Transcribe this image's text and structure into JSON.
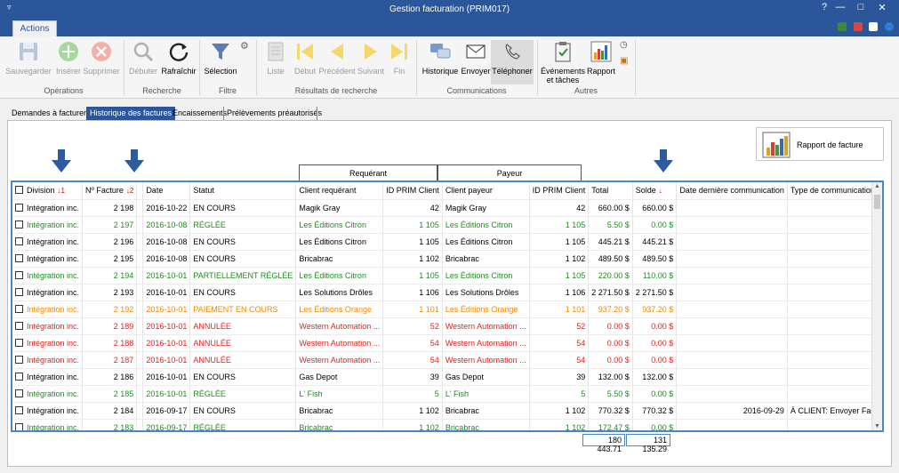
{
  "window": {
    "title": "Gestion facturation (PRIM017)"
  },
  "ribbon_tab": "Actions",
  "ribbon": {
    "buttons": [
      {
        "label": "Sauvegarder",
        "icon": "save-icon",
        "enabled": false
      },
      {
        "label": "Insérer",
        "icon": "plus-icon",
        "enabled": false
      },
      {
        "label": "Supprimer",
        "icon": "delete-icon",
        "enabled": false
      },
      {
        "label": "Débuter",
        "icon": "search-icon",
        "enabled": false
      },
      {
        "label": "Rafraîchir",
        "icon": "refresh-icon",
        "enabled": true
      },
      {
        "label": "Sélection",
        "icon": "filter-icon",
        "enabled": true
      },
      {
        "label": "Liste",
        "icon": "list-icon",
        "enabled": false
      },
      {
        "label": "Début",
        "icon": "first-icon",
        "enabled": false
      },
      {
        "label": "Précédent",
        "icon": "previous-icon",
        "enabled": false
      },
      {
        "label": "Suivant",
        "icon": "next-icon",
        "enabled": false
      },
      {
        "label": "Fin",
        "icon": "last-icon",
        "enabled": false
      },
      {
        "label": "Historique",
        "icon": "chat-history-icon",
        "enabled": true
      },
      {
        "label": "Envoyer",
        "icon": "email-icon",
        "enabled": true
      },
      {
        "label": "Téléphoner",
        "icon": "phone-icon",
        "enabled": true
      },
      {
        "label": "Événements\net tâches",
        "icon": "clipboard-check-icon",
        "enabled": true
      },
      {
        "label": "Rapport",
        "icon": "bar-chart-icon",
        "enabled": true
      }
    ],
    "groups": [
      "Opérations",
      "Recherche",
      "Filtre",
      "Résultats de recherche",
      "Communications",
      "Autres"
    ]
  },
  "tabs": [
    "Demandes à facturer",
    "Historique des factures",
    "Encaissements",
    "Prélèvements préautorisés"
  ],
  "selected_tab": "Historique des factures",
  "report_button": "Rapport de facture",
  "group_headers": {
    "requerant": "Requérant",
    "payeur": "Payeur"
  },
  "columns": [
    "Division",
    "Nº Facture",
    "Date",
    "Statut",
    "Client requérant",
    "ID PRIM Client",
    "Client payeur",
    "ID PRIM Client",
    "Total",
    "Solde",
    "Date dernière communication",
    "Type de communication"
  ],
  "rows": [
    {
      "color": "black",
      "division": "Intégration inc.",
      "facture": "2 198",
      "date": "2016-10-22",
      "statut": "EN COURS",
      "requerant": "Magik Gray",
      "id_req": "42",
      "payeur": "Magik Gray",
      "id_pay": "42",
      "total": "660.00 $",
      "solde": "660.00 $",
      "date_comm": "",
      "type_comm": ""
    },
    {
      "color": "green",
      "division": "Intégration inc.",
      "facture": "2 197",
      "date": "2016-10-08",
      "statut": "RÉGLÉE",
      "requerant": "Les Éditions Citron",
      "id_req": "1 105",
      "payeur": "Les Éditions Citron",
      "id_pay": "1 105",
      "total": "5.50 $",
      "solde": "0.00 $",
      "date_comm": "",
      "type_comm": ""
    },
    {
      "color": "black",
      "division": "Intégration inc.",
      "facture": "2 196",
      "date": "2016-10-08",
      "statut": "EN COURS",
      "requerant": "Les Éditions Citron",
      "id_req": "1 105",
      "payeur": "Les Éditions Citron",
      "id_pay": "1 105",
      "total": "445.21 $",
      "solde": "445.21 $",
      "date_comm": "",
      "type_comm": ""
    },
    {
      "color": "black",
      "division": "Intégration inc.",
      "facture": "2 195",
      "date": "2016-10-08",
      "statut": "EN COURS",
      "requerant": "Bricabrac",
      "id_req": "1 102",
      "payeur": "Bricabrac",
      "id_pay": "1 102",
      "total": "489.50 $",
      "solde": "489.50 $",
      "date_comm": "",
      "type_comm": ""
    },
    {
      "color": "green",
      "division": "Intégration inc.",
      "facture": "2 194",
      "date": "2016-10-01",
      "statut": "PARTIELLEMENT RÉGLÉE",
      "requerant": "Les Éditions Citron",
      "id_req": "1 105",
      "payeur": "Les Éditions Citron",
      "id_pay": "1 105",
      "total": "220.00 $",
      "solde": "110.00 $",
      "date_comm": "",
      "type_comm": ""
    },
    {
      "color": "black",
      "division": "Intégration inc.",
      "facture": "2 193",
      "date": "2016-10-01",
      "statut": "EN COURS",
      "requerant": "Les Solutions Drôles",
      "id_req": "1 106",
      "payeur": "Les Solutions Drôles",
      "id_pay": "1 106",
      "total": "2 271.50 $",
      "solde": "2 271.50 $",
      "date_comm": "",
      "type_comm": ""
    },
    {
      "color": "orange",
      "division": "Intégration inc.",
      "facture": "2 192",
      "date": "2016-10-01",
      "statut": "PAIEMENT EN COURS",
      "requerant": "Les Éditions Orange",
      "id_req": "1 101",
      "payeur": "Les Éditions Orange",
      "id_pay": "1 101",
      "total": "937.20 $",
      "solde": "937.20 $",
      "date_comm": "",
      "type_comm": ""
    },
    {
      "color": "red",
      "division": "Intégration inc.",
      "facture": "2 189",
      "date": "2016-10-01",
      "statut": "ANNULÉE",
      "requerant": "Western Automation ...",
      "id_req": "52",
      "payeur": "Western Automation ...",
      "id_pay": "52",
      "total": "0.00 $",
      "solde": "0.00 $",
      "date_comm": "",
      "type_comm": ""
    },
    {
      "color": "red",
      "division": "Intégration inc.",
      "facture": "2 188",
      "date": "2016-10-01",
      "statut": "ANNULÉE",
      "requerant": "Western Automation ...",
      "id_req": "54",
      "payeur": "Western Automation ...",
      "id_pay": "54",
      "total": "0.00 $",
      "solde": "0.00 $",
      "date_comm": "",
      "type_comm": ""
    },
    {
      "color": "red",
      "division": "Intégration inc.",
      "facture": "2 187",
      "date": "2016-10-01",
      "statut": "ANNULÉE",
      "requerant": "Western Automation ...",
      "id_req": "54",
      "payeur": "Western Automation ...",
      "id_pay": "54",
      "total": "0.00 $",
      "solde": "0.00 $",
      "date_comm": "",
      "type_comm": ""
    },
    {
      "color": "black",
      "division": "Intégration inc.",
      "facture": "2 186",
      "date": "2016-10-01",
      "statut": "EN COURS",
      "requerant": "Gas Depot",
      "id_req": "39",
      "payeur": "Gas Depot",
      "id_pay": "39",
      "total": "132.00 $",
      "solde": "132.00 $",
      "date_comm": "",
      "type_comm": ""
    },
    {
      "color": "green",
      "division": "Intégration inc.",
      "facture": "2 185",
      "date": "2016-10-01",
      "statut": "RÉGLÉE",
      "requerant": "L' Fish",
      "id_req": "5",
      "payeur": "L' Fish",
      "id_pay": "5",
      "total": "5.50 $",
      "solde": "0.00 $",
      "date_comm": "",
      "type_comm": ""
    },
    {
      "color": "black",
      "division": "Intégration inc.",
      "facture": "2 184",
      "date": "2016-09-17",
      "statut": "EN COURS",
      "requerant": "Bricabrac",
      "id_req": "1 102",
      "payeur": "Bricabrac",
      "id_pay": "1 102",
      "total": "770.32 $",
      "solde": "770.32 $",
      "date_comm": "2016-09-29",
      "type_comm": "À CLIENT: Envoyer Facture"
    },
    {
      "color": "green",
      "division": "Intégration inc.",
      "facture": "2 183",
      "date": "2016-09-17",
      "statut": "RÉGLÉE",
      "requerant": "Bricabrac",
      "id_req": "1 102",
      "payeur": "Bricabrac",
      "id_pay": "1 102",
      "total": "172.47 $",
      "solde": "0.00 $",
      "date_comm": "",
      "type_comm": ""
    }
  ],
  "totals": {
    "total": "180 443.71",
    "solde": "131 135.29"
  },
  "colors": {
    "accent": "#2b579a",
    "green": "#1e8c1e",
    "red": "#e32020",
    "orange": "#f08a00",
    "arrow": "#2e5a9e"
  }
}
